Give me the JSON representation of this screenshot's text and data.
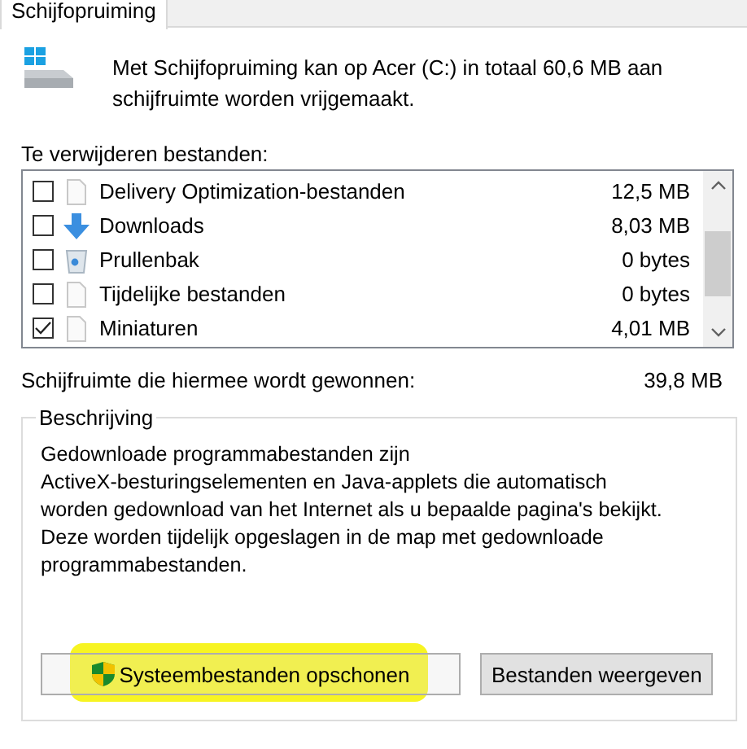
{
  "tabs": [
    {
      "label": "Schijfopruiming",
      "selected": true
    }
  ],
  "header": {
    "text": "Met Schijfopruiming kan op Acer (C:) in totaal 60,6 MB aan\nschijfruimte worden vrijgemaakt."
  },
  "files_label": "Te verwijderen bestanden:",
  "files": [
    {
      "name": "Delivery Optimization-bestanden",
      "size": "12,5 MB",
      "checked": false,
      "kind": "file"
    },
    {
      "name": "Downloads",
      "size": "8,03 MB",
      "checked": false,
      "kind": "download"
    },
    {
      "name": "Prullenbak",
      "size": "0 bytes",
      "checked": false,
      "kind": "recycle"
    },
    {
      "name": "Tijdelijke bestanden",
      "size": "0 bytes",
      "checked": false,
      "kind": "file"
    },
    {
      "name": "Miniaturen",
      "size": "4,01 MB",
      "checked": true,
      "kind": "file"
    }
  ],
  "gained": {
    "label": "Schijfruimte die hiermee wordt gewonnen:",
    "value": "39,8 MB"
  },
  "description": {
    "title": "Beschrijving",
    "text": "Gedownloade programmabestanden zijn\nActiveX-besturingselementen en Java-applets die automatisch\nworden gedownload van het Internet als u bepaalde pagina's bekijkt.\nDeze worden tijdelijk opgeslagen in de map met gedownloade\nprogrammabestanden."
  },
  "buttons": [
    {
      "label": "Systeembestanden opschonen",
      "kind": "shield",
      "highlighted": true
    },
    {
      "label": "Bestanden weergeven",
      "kind": "plain",
      "highlighted": false
    }
  ]
}
